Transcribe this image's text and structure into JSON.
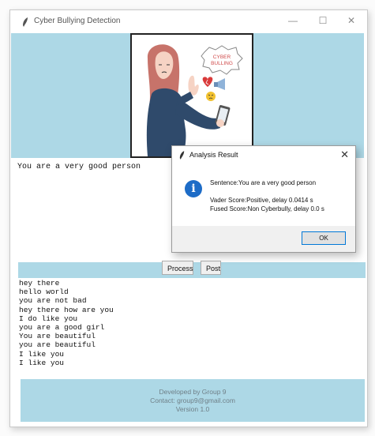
{
  "window": {
    "title": "Cyber Bullying Detection",
    "controls": {
      "minimize": "—",
      "maximize": "☐",
      "close": "✕"
    },
    "accent_color": "#add8e6"
  },
  "illustration": {
    "bubble_text_1": "CYBER",
    "bubble_text_2": "BULLING"
  },
  "input": {
    "sentence": "You are a very good person"
  },
  "toolbar": {
    "process_label": "Process",
    "post_label": "Post"
  },
  "history": {
    "items": [
      "hey there",
      "hello world",
      "you are not bad",
      "hey there how are you",
      "I do like you",
      "you are a good girl",
      "You are beautiful",
      "you are beautiful",
      "I like you",
      "I like you"
    ]
  },
  "footer": {
    "line1": "Developed by Group 9",
    "line2": "Contact: group9@gmail.com",
    "line3": "Version 1.0"
  },
  "dialog": {
    "title": "Analysis Result",
    "close": "✕",
    "info_glyph": "i",
    "sentence_line": "Sentence:You are a very good person",
    "vader_line": "Vader Score:Positive, delay 0.0414 s",
    "fused_line": "Fused Score:Non Cyberbully, delay 0.0 s",
    "ok_label": "OK"
  }
}
